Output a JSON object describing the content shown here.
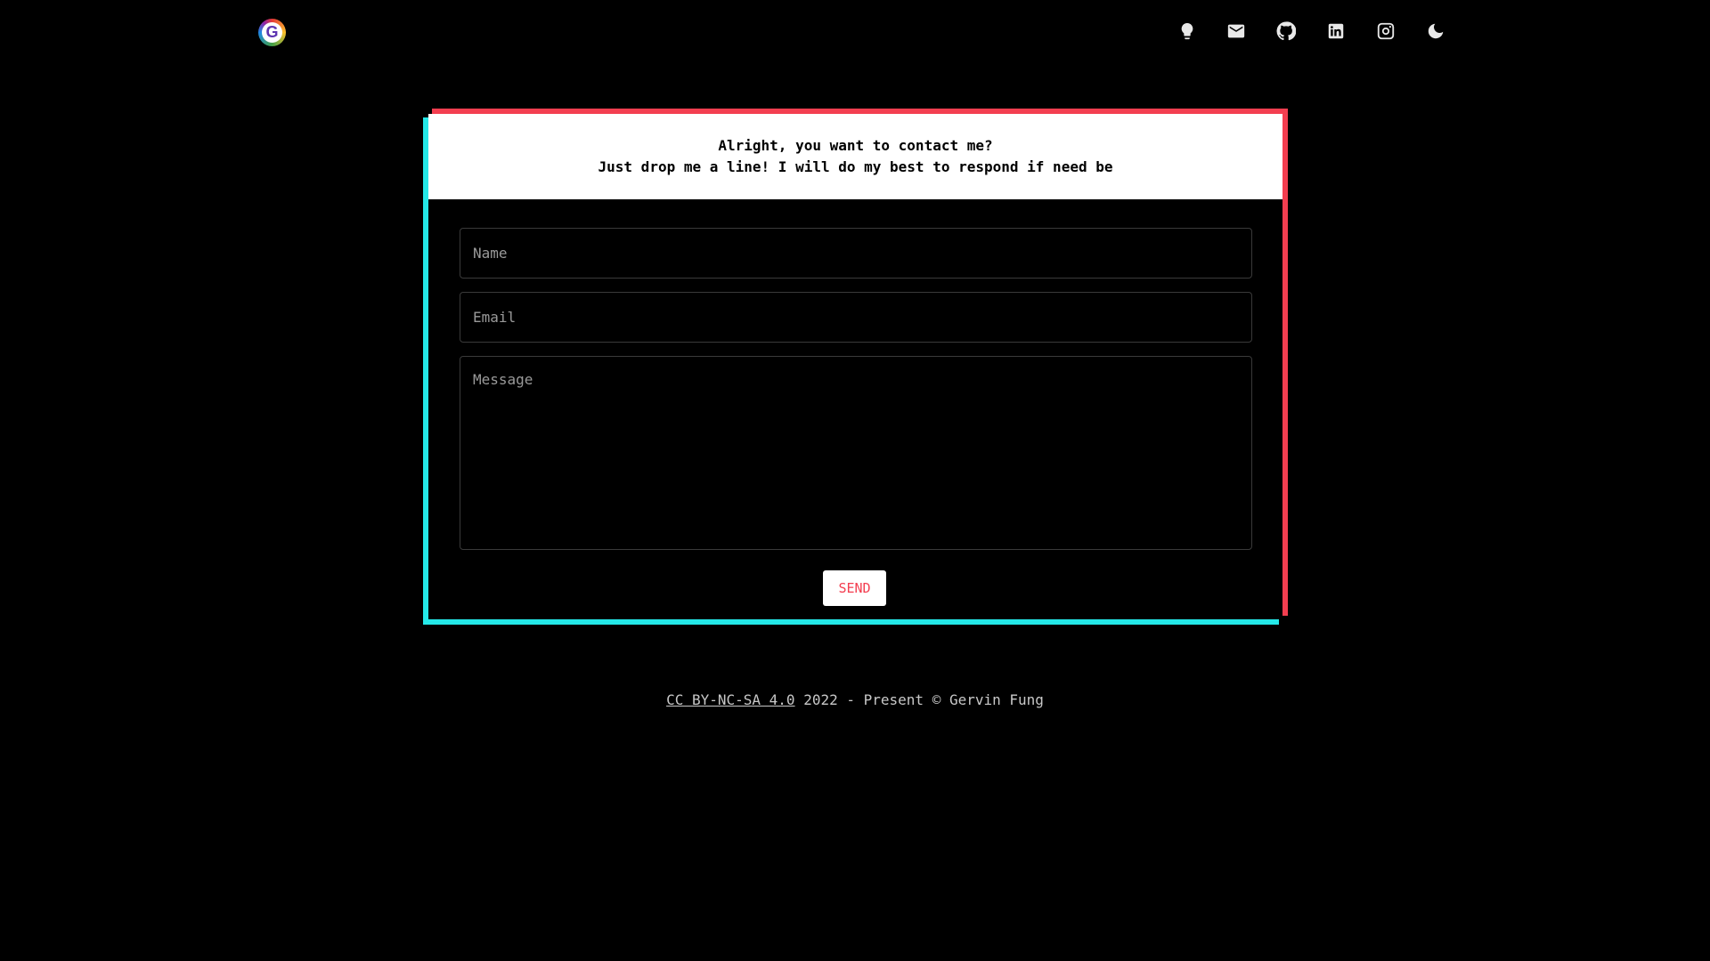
{
  "header": {
    "logo_letter": "G",
    "nav_icons": [
      "lightbulb-icon",
      "mail-icon",
      "github-icon",
      "linkedin-icon",
      "instagram-icon",
      "moon-icon"
    ]
  },
  "contact": {
    "heading_line1": "Alright, you want to contact me?",
    "heading_line2": "Just drop me a line! I will do my best to respond if need be",
    "name_placeholder": "Name",
    "email_placeholder": "Email",
    "message_placeholder": "Message",
    "name_value": "",
    "email_value": "",
    "message_value": "",
    "send_label": "SEND"
  },
  "footer": {
    "license_link": "CC BY-NC-SA 4.0",
    "text": " 2022 - Present © Gervin Fung"
  },
  "colors": {
    "accent_red": "#f33e50",
    "accent_cyan": "#24e8e8",
    "background": "#000000"
  }
}
